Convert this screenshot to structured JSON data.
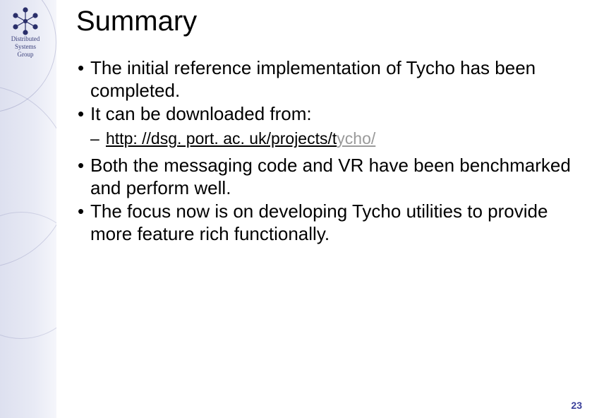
{
  "sidebar": {
    "group_line1": "Distributed",
    "group_line2": "Systems",
    "group_line3": "Group"
  },
  "slide": {
    "title": "Summary",
    "bullets": {
      "b1": "The initial reference implementation of Tycho has been completed.",
      "b2": "It can be downloaded from:",
      "link_main": "http: //dsg. port. ac. uk/projects/t",
      "link_tail": "ycho/",
      "b3": "Both the messaging code and VR have been benchmarked and perform well.",
      "b4": "The focus now is on developing Tycho utilities to provide more feature rich functionally."
    },
    "page_number": "23"
  }
}
